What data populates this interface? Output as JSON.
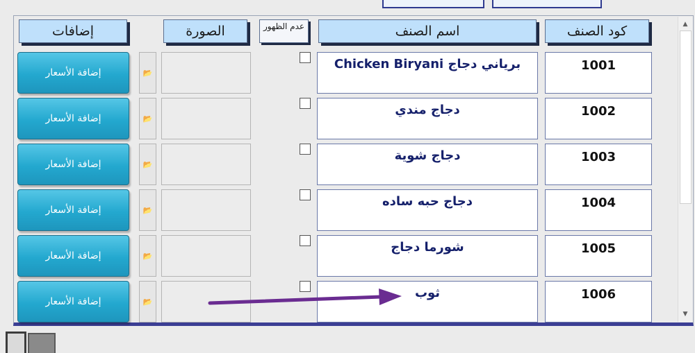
{
  "headers": {
    "code": "كود الصنف",
    "name": "اسم الصنف",
    "hidden": "عدم الظهور",
    "image": "الصورة",
    "additions": "إضافات"
  },
  "rows": [
    {
      "code": "1001",
      "name": "برياني دجاج Chicken Biryani",
      "price_button": "إضافة الأسعار"
    },
    {
      "code": "1002",
      "name": "دجاج مندي",
      "price_button": "إضافة الأسعار"
    },
    {
      "code": "1003",
      "name": "دجاج شوية",
      "price_button": "إضافة الأسعار"
    },
    {
      "code": "1004",
      "name": "دجاج حبه ساده",
      "price_button": "إضافة الأسعار"
    },
    {
      "code": "1005",
      "name": "شورما دجاج",
      "price_button": "إضافة الأسعار"
    },
    {
      "code": "1006",
      "name": "ثوب",
      "price_button": "إضافة الأسعار"
    }
  ],
  "icons": {
    "folder": "folder-icon",
    "scroll_up": "chevron-up-icon",
    "scroll_down": "chevron-down-icon",
    "annotation": "arrow-annotation"
  },
  "colors": {
    "header_bg": "#bfe0fb",
    "button": "#23a8cf",
    "name_text": "#15206b",
    "annotation_arrow": "#6a2c91"
  }
}
